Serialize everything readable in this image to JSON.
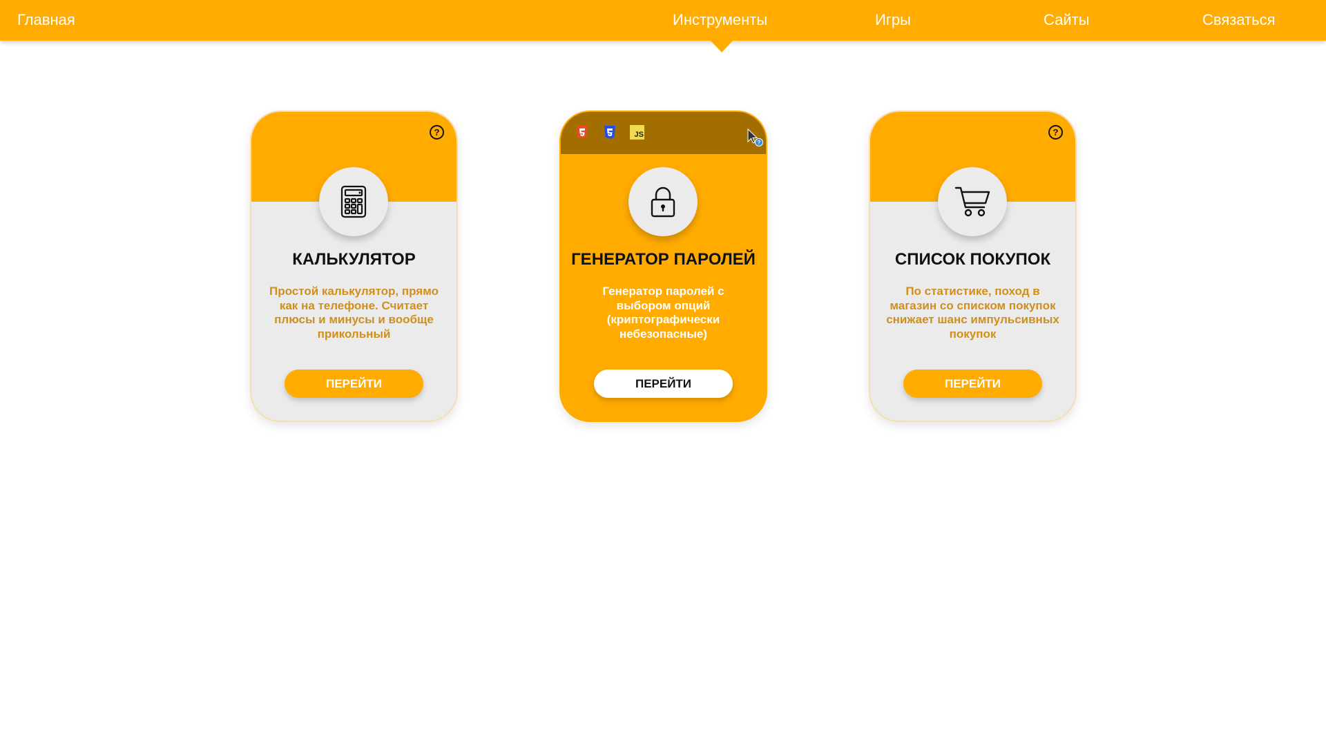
{
  "nav": {
    "home": "Главная",
    "tools": "Инструменты",
    "games": "Игры",
    "sites": "Сайты",
    "contact": "Связаться"
  },
  "cards": [
    {
      "title": "КАЛЬКУЛЯТОР",
      "description": "Простой калькулятор, прямо как на телефоне. Считает плюсы и минусы и вообще прикольный",
      "button": "ПЕРЕЙТИ",
      "help": "?",
      "icon": "calculator-icon"
    },
    {
      "title": "ГЕНЕРАТОР ПАРОЛЕЙ",
      "description": "Генератор паролей с выбором опций (криптографически небезопасные)",
      "button": "ПЕРЕЙТИ",
      "icon": "lock-icon",
      "tech_icons": [
        "html5-icon",
        "css3-icon",
        "js-icon"
      ],
      "js_label": "JS"
    },
    {
      "title": "СПИСОК ПОКУПОК",
      "description": "По статистике, поход в магазин со списком покупок снижает шанс импульсивных покупок",
      "button": "ПЕРЕЙТИ",
      "help": "?",
      "icon": "shopping-cart-icon"
    }
  ],
  "colors": {
    "accent": "#ffab00",
    "accent_dark": "#a36e00",
    "card_bg": "#ebebeb",
    "desc_text": "#d08f1c"
  }
}
